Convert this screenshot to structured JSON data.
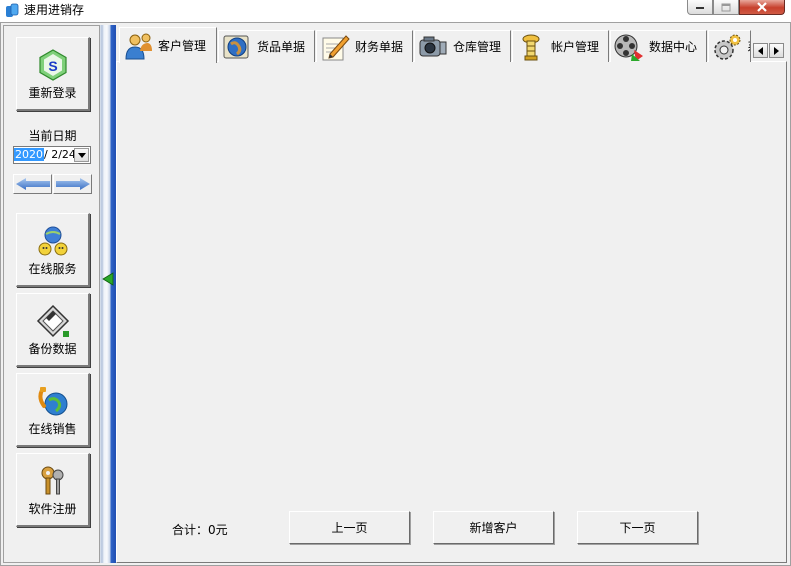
{
  "window": {
    "title": "速用进销存",
    "min_glyph": "─",
    "max_glyph": "□",
    "close_glyph": "✕"
  },
  "sidebar": {
    "relogin_label": "重新登录",
    "date_label": "当前日期",
    "date_year": "2020",
    "date_rest": "/ 2/24",
    "buttons": [
      {
        "label": "在线服务",
        "icon": "online-service-icon"
      },
      {
        "label": "备份数据",
        "icon": "backup-disk-icon"
      },
      {
        "label": "在线销售",
        "icon": "online-sales-icon"
      },
      {
        "label": "软件注册",
        "icon": "register-keys-icon"
      }
    ]
  },
  "tabs": [
    {
      "label": "客户管理",
      "icon": "customers-icon",
      "active": true
    },
    {
      "label": "货品单据",
      "icon": "goods-globe-icon",
      "active": false
    },
    {
      "label": "财务单据",
      "icon": "pencil-icon",
      "active": false
    },
    {
      "label": "仓库管理",
      "icon": "warehouse-camera-icon",
      "active": false
    },
    {
      "label": "帐户管理",
      "icon": "account-tower-icon",
      "active": false
    },
    {
      "label": "数据中心",
      "icon": "film-reel-icon",
      "active": false
    },
    {
      "label": "系",
      "icon": "settings-gears-icon",
      "active": false
    }
  ],
  "footer": {
    "total_label": "合计：0元",
    "prev_label": "上一页",
    "add_label": "新增客户",
    "next_label": "下一页"
  },
  "colors": {
    "accent_blue": "#2252b5",
    "splitter_arrow": "#1a8a1a",
    "date_highlight": "#3399ff"
  }
}
